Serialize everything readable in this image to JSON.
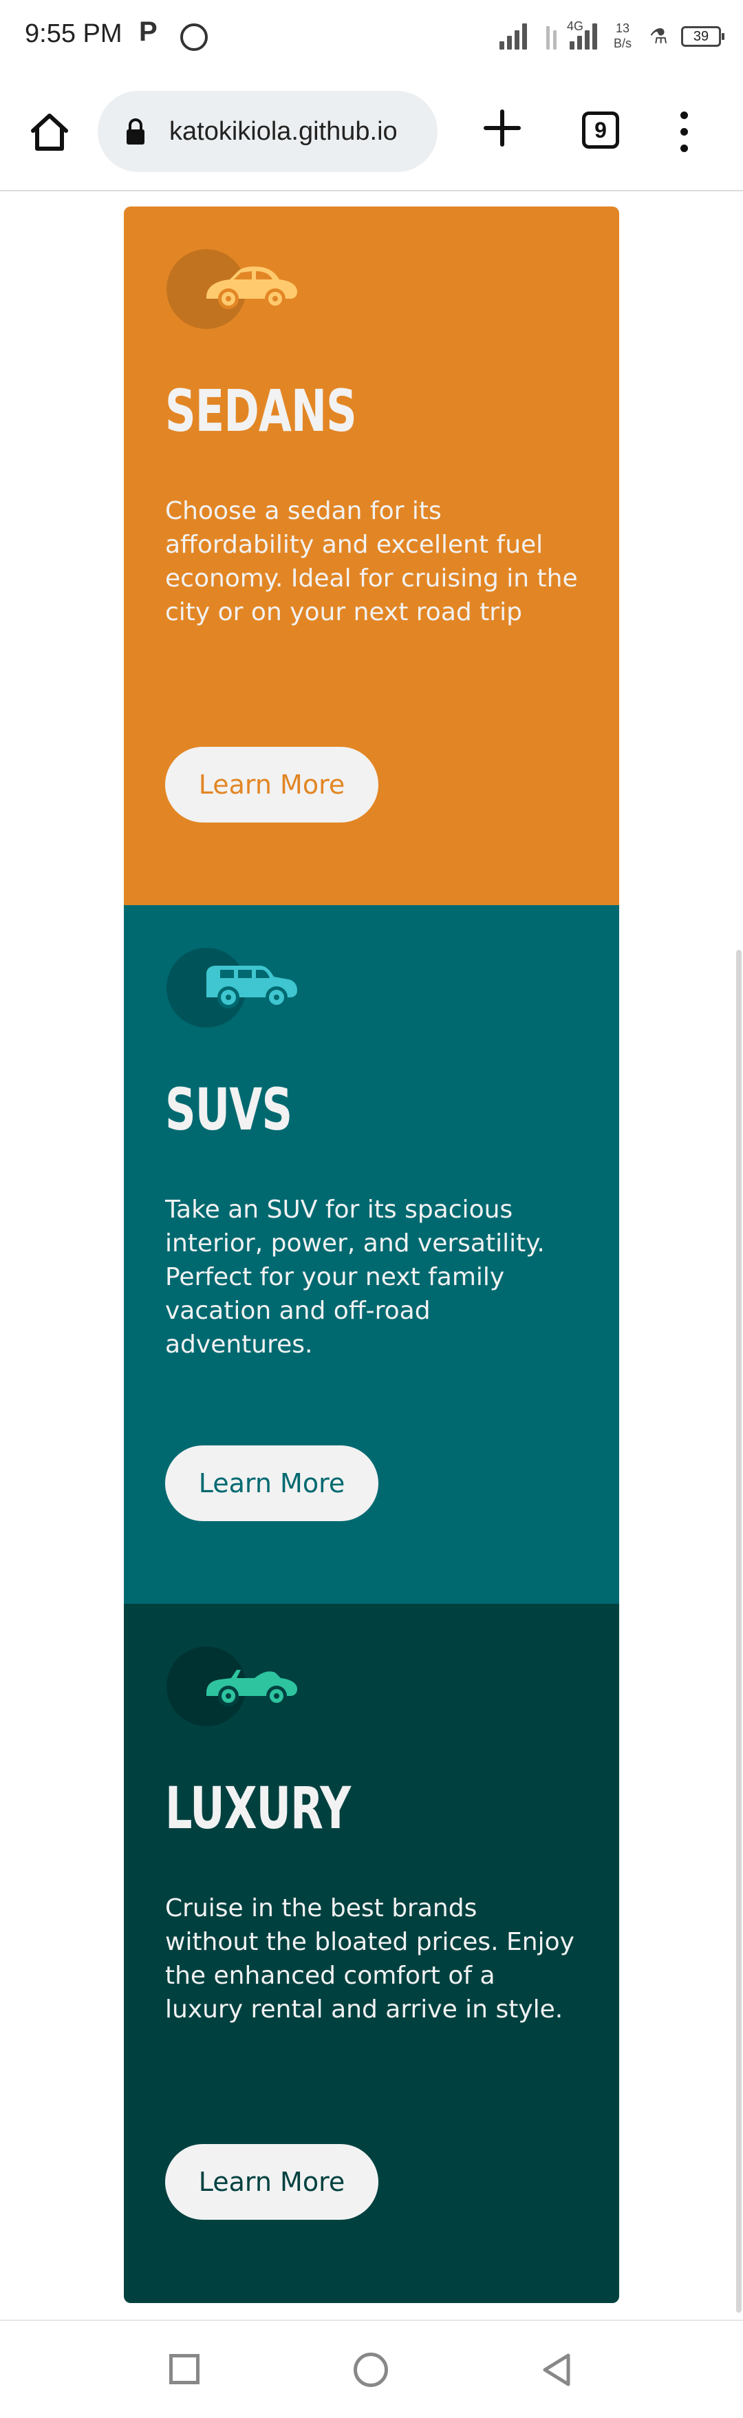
{
  "status_bar": {
    "time": "9:55 PM",
    "network_label": "4G",
    "speed_value": "13",
    "speed_unit": "B/s",
    "battery": "39"
  },
  "browser": {
    "url": "katokikiola.github.io",
    "tab_count": "9"
  },
  "cards": [
    {
      "icon": "sedan-car-icon",
      "title": "Sedans",
      "text": "Choose a sedan for its affordability and excellent fuel economy. Ideal for cruising in the city or on your next road trip",
      "button": "Learn More",
      "bg_color": "#e28625",
      "btn_text_color": "#e28625",
      "icon_color": "#ffca6e"
    },
    {
      "icon": "suv-car-icon",
      "title": "SUVs",
      "text": "Take an SUV for its spacious interior, power, and versatility. Perfect for your next family vacation and off-road adventures.",
      "button": "Learn More",
      "bg_color": "#006970",
      "btn_text_color": "#006970",
      "icon_color": "#3fc6d0"
    },
    {
      "icon": "luxury-convertible-icon",
      "title": "Luxury",
      "text": "Cruise in the best brands without the bloated prices. Enjoy the enhanced comfort of a luxury rental and arrive in style.",
      "button": "Learn More",
      "bg_color": "#004140",
      "btn_text_color": "#004140",
      "icon_color": "#2ec4a0"
    }
  ]
}
